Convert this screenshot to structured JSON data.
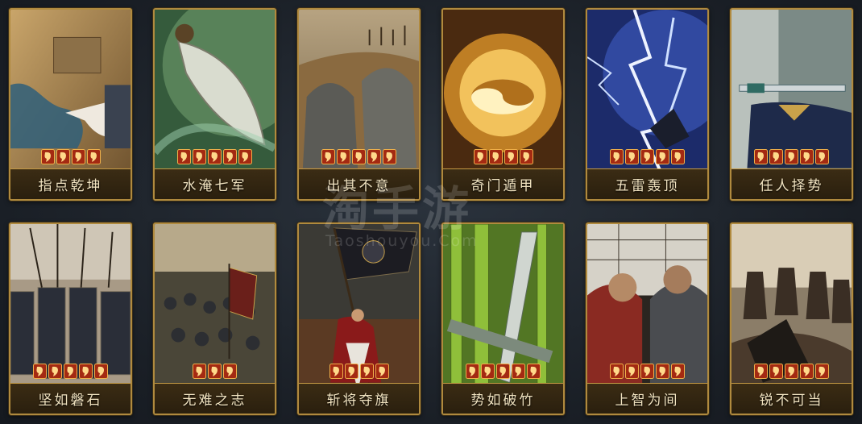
{
  "watermark": {
    "main": "淘手游",
    "sub": "Taoshouyou.Com"
  },
  "cards": [
    {
      "name": "指点乾坤",
      "stars": 4,
      "art": "map"
    },
    {
      "name": "水淹七军",
      "stars": 5,
      "art": "blade"
    },
    {
      "name": "出其不意",
      "stars": 5,
      "art": "statues"
    },
    {
      "name": "奇门遁甲",
      "stars": 4,
      "art": "taiji"
    },
    {
      "name": "五雷轰顶",
      "stars": 5,
      "art": "lightning"
    },
    {
      "name": "任人择势",
      "stars": 5,
      "art": "sword"
    },
    {
      "name": "坚如磐石",
      "stars": 5,
      "art": "shields"
    },
    {
      "name": "无难之志",
      "stars": 3,
      "art": "army"
    },
    {
      "name": "斩将夺旗",
      "stars": 4,
      "art": "banner"
    },
    {
      "name": "势如破竹",
      "stars": 5,
      "art": "bamboo"
    },
    {
      "name": "上智为间",
      "stars": 5,
      "art": "spies"
    },
    {
      "name": "锐不可当",
      "stars": 5,
      "art": "charge"
    }
  ]
}
